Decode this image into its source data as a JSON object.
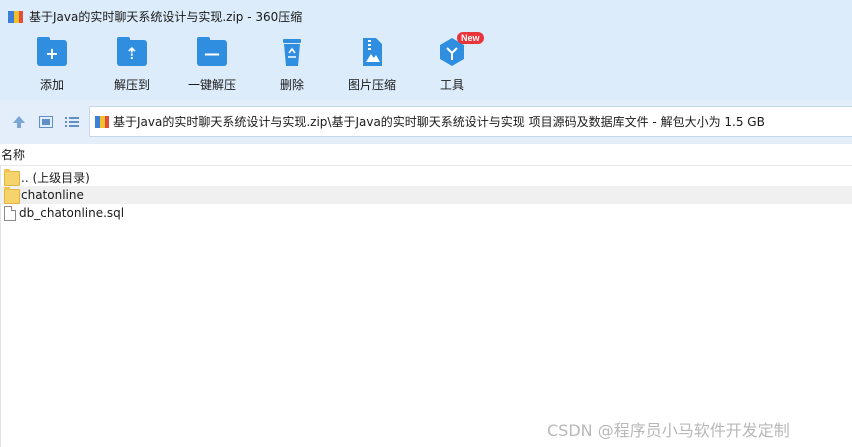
{
  "window": {
    "title": "基于Java的实时聊天系统设计与实现.zip - 360压缩"
  },
  "toolbar": {
    "items": [
      {
        "label": "添加",
        "icon": "add-folder-icon"
      },
      {
        "label": "解压到",
        "icon": "extract-to-folder-icon"
      },
      {
        "label": "一键解压",
        "icon": "quick-extract-folder-icon"
      },
      {
        "label": "删除",
        "icon": "recycle-bin-icon"
      },
      {
        "label": "图片压缩",
        "icon": "image-compress-icon"
      },
      {
        "label": "工具",
        "icon": "tools-cube-icon",
        "badge": "New"
      }
    ]
  },
  "address": {
    "path": "基于Java的实时聊天系统设计与实现.zip\\基于Java的实时聊天系统设计与实现 项目源码及数据库文件 - 解包大小为 1.5 GB"
  },
  "list": {
    "header": "名称",
    "rows": [
      {
        "name": ".. (上级目录)",
        "type": "folder"
      },
      {
        "name": "chatonline",
        "type": "folder"
      },
      {
        "name": "db_chatonline.sql",
        "type": "file"
      }
    ]
  },
  "watermark": "CSDN @程序员小马软件开发定制",
  "colors": {
    "chrome": "#dcecfb",
    "accent": "#2f8ee0",
    "badge": "#e8343a"
  }
}
